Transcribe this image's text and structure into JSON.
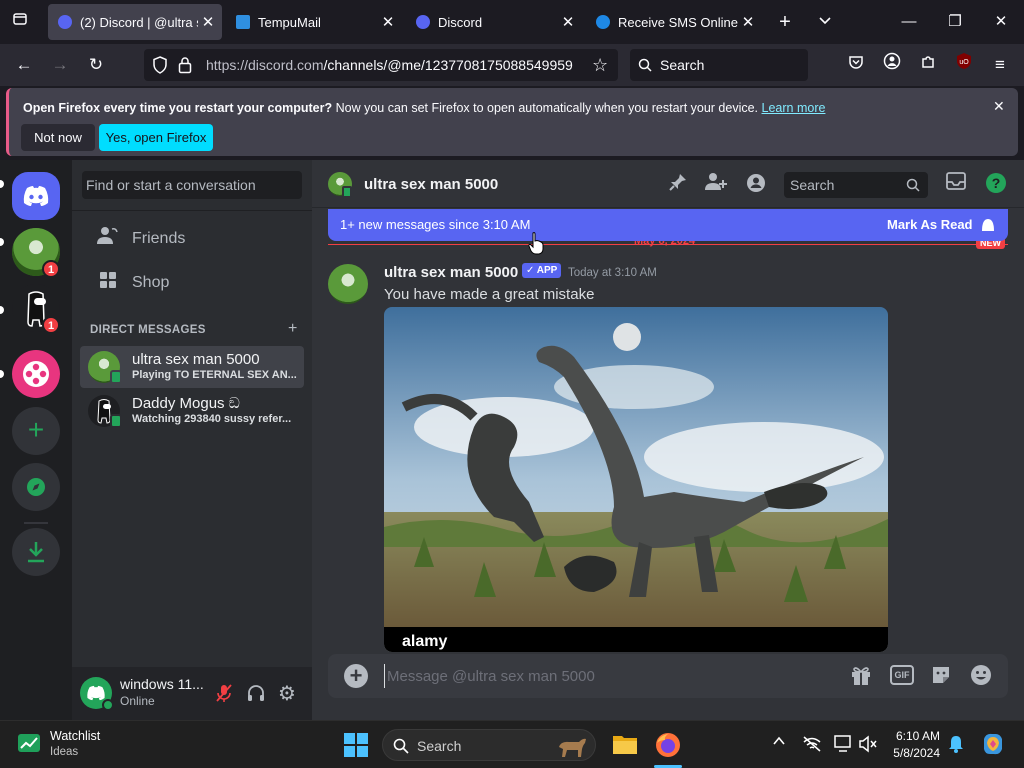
{
  "browser": {
    "tabs": [
      {
        "title": "(2) Discord | @ultra sex man 5000",
        "active": true
      },
      {
        "title": "TempuMail",
        "active": false
      },
      {
        "title": "Discord",
        "active": false
      },
      {
        "title": "Receive SMS Online - SMS",
        "active": false
      }
    ],
    "url_host": "https://discord.com",
    "url_path": "/channels/@me/1237708175088549959",
    "search_placeholder": "Search"
  },
  "notification": {
    "bold": "Open Firefox every time you restart your computer?",
    "text": " Now you can set Firefox to open automatically when you restart your device.",
    "link": "Learn more",
    "btn_dismiss": "Not now",
    "btn_accept": "Yes, open Firefox"
  },
  "discord": {
    "guild_badges": [
      "1",
      "1"
    ],
    "dm_search_placeholder": "Find or start a conversation",
    "nav": {
      "friends": "Friends",
      "shop": "Shop"
    },
    "dm_header": "DIRECT MESSAGES",
    "dms": [
      {
        "name": "ultra sex man 5000",
        "status": "Playing TO ETERNAL SEX AN..."
      },
      {
        "name": "Daddy Mogus ඞ",
        "status": "Watching 293840 sussy refer..."
      }
    ],
    "user": {
      "name": "windows 11...",
      "status": "Online"
    },
    "chat": {
      "title": "ultra sex man 5000",
      "search_placeholder": "Search",
      "new_messages": "1+ new messages since 3:10 AM",
      "mark_read": "Mark As Read",
      "date_divider": "May 8, 2024",
      "new_tag": "NEW",
      "message": {
        "author": "ultra sex man 5000",
        "tag": "✓ APP",
        "time": "Today at 3:10 AM",
        "text": "You have made a great mistake"
      },
      "attachment_watermark": "alamy",
      "composer_placeholder": "Message @ultra sex man 5000"
    }
  },
  "taskbar": {
    "widget_title": "Watchlist",
    "widget_sub": "Ideas",
    "search": "Search",
    "time": "6:10 AM",
    "date": "5/8/2024"
  },
  "colors": {
    "discord_blurple": "#5865f2",
    "online_green": "#23a55a",
    "danger_red": "#f23f43"
  }
}
